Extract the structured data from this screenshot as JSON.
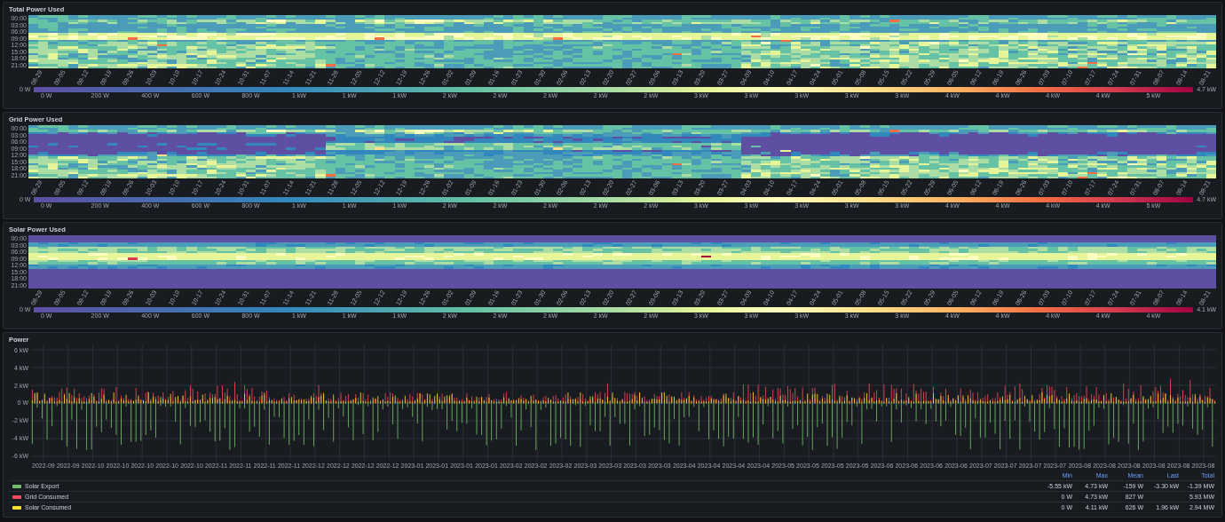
{
  "heatmaps": [
    {
      "title": "Total Power Used",
      "kind": "total",
      "y_labels": [
        "00:00",
        "03:00",
        "06:00",
        "09:00",
        "12:00",
        "15:00",
        "18:00",
        "21:00"
      ],
      "x_labels": [
        "08-29",
        "09-05",
        "09-12",
        "09-19",
        "09-26",
        "10-03",
        "10-10",
        "10-17",
        "10-24",
        "10-31",
        "11-07",
        "11-14",
        "11-21",
        "11-28",
        "12-05",
        "12-12",
        "12-19",
        "12-26",
        "01-02",
        "01-09",
        "01-16",
        "01-23",
        "01-30",
        "02-06",
        "02-13",
        "02-20",
        "02-27",
        "03-06",
        "03-13",
        "03-20",
        "03-27",
        "04-03",
        "04-10",
        "04-17",
        "04-24",
        "05-01",
        "05-08",
        "05-15",
        "05-22",
        "05-29",
        "06-05",
        "06-12",
        "06-19",
        "06-26",
        "07-03",
        "07-10",
        "07-17",
        "07-24",
        "07-31",
        "08-07",
        "08-14",
        "08-21"
      ],
      "scale": {
        "min_label": "0 W",
        "max_label": "4.7 kW",
        "ticks": [
          "0 W",
          "200 W",
          "400 W",
          "600 W",
          "800 W",
          "1 kW",
          "1 kW",
          "1 kW",
          "2 kW",
          "2 kW",
          "2 kW",
          "2 kW",
          "2 kW",
          "3 kW",
          "3 kW",
          "3 kW",
          "3 kW",
          "3 kW",
          "4 kW",
          "4 kW",
          "4 kW",
          "4 kW",
          "5 kW"
        ]
      }
    },
    {
      "title": "Grid Power Used",
      "kind": "grid",
      "y_labels": [
        "00:00",
        "03:00",
        "06:00",
        "09:00",
        "12:00",
        "15:00",
        "18:00",
        "21:00"
      ],
      "x_labels": [
        "08-29",
        "09-05",
        "09-12",
        "09-19",
        "09-26",
        "10-03",
        "10-10",
        "10-17",
        "10-24",
        "10-31",
        "11-07",
        "11-14",
        "11-21",
        "11-28",
        "12-05",
        "12-12",
        "12-19",
        "12-26",
        "01-02",
        "01-09",
        "01-16",
        "01-23",
        "01-30",
        "02-06",
        "02-13",
        "02-20",
        "02-27",
        "03-06",
        "03-13",
        "03-20",
        "03-27",
        "04-03",
        "04-10",
        "04-17",
        "04-24",
        "05-01",
        "05-08",
        "05-15",
        "05-22",
        "05-29",
        "06-05",
        "06-12",
        "06-19",
        "06-26",
        "07-03",
        "07-10",
        "07-17",
        "07-24",
        "07-31",
        "08-07",
        "08-14",
        "08-21"
      ],
      "scale": {
        "min_label": "0 W",
        "max_label": "4.7 kW",
        "ticks": [
          "0 W",
          "200 W",
          "400 W",
          "600 W",
          "800 W",
          "1 kW",
          "1 kW",
          "1 kW",
          "2 kW",
          "2 kW",
          "2 kW",
          "2 kW",
          "2 kW",
          "3 kW",
          "3 kW",
          "3 kW",
          "3 kW",
          "3 kW",
          "4 kW",
          "4 kW",
          "4 kW",
          "4 kW",
          "5 kW"
        ]
      }
    },
    {
      "title": "Solar Power Used",
      "kind": "solar",
      "y_labels": [
        "00:00",
        "03:00",
        "06:00",
        "09:00",
        "12:00",
        "15:00",
        "18:00",
        "21:00"
      ],
      "x_labels": [
        "08-29",
        "09-05",
        "09-12",
        "09-19",
        "09-26",
        "10-03",
        "10-10",
        "10-17",
        "10-24",
        "10-31",
        "11-07",
        "11-14",
        "11-21",
        "11-28",
        "12-05",
        "12-12",
        "12-19",
        "12-26",
        "01-02",
        "01-09",
        "01-16",
        "01-23",
        "01-30",
        "02-06",
        "02-13",
        "02-20",
        "02-27",
        "03-06",
        "03-13",
        "03-20",
        "03-27",
        "04-03",
        "04-10",
        "04-17",
        "04-24",
        "05-01",
        "05-08",
        "05-15",
        "05-22",
        "05-29",
        "06-05",
        "06-12",
        "06-19",
        "06-26",
        "07-03",
        "07-10",
        "07-17",
        "07-24",
        "07-31",
        "08-07",
        "08-14",
        "08-21"
      ],
      "scale": {
        "min_label": "0 W",
        "max_label": "4.1 kW",
        "ticks": [
          "0 W",
          "200 W",
          "400 W",
          "600 W",
          "800 W",
          "1 kW",
          "1 kW",
          "1 kW",
          "2 kW",
          "2 kW",
          "2 kW",
          "2 kW",
          "2 kW",
          "3 kW",
          "3 kW",
          "3 kW",
          "3 kW",
          "3 kW",
          "4 kW",
          "4 kW",
          "4 kW",
          "4 kW",
          "4 kW"
        ]
      }
    }
  ],
  "power": {
    "title": "Power",
    "y_ticks": [
      "6 kW",
      "4 kW",
      "2 kW",
      "0 W",
      "-2 kW",
      "-4 kW",
      "-6 kW"
    ],
    "x_labels": [
      "2022-09",
      "2022-09",
      "2022-10",
      "2022-10",
      "2022-10",
      "2022-10",
      "2022-10",
      "2022-11",
      "2022-11",
      "2022-11",
      "2022-11",
      "2022-12",
      "2022-12",
      "2022-12",
      "2022-12",
      "2023-01",
      "2023-01",
      "2023-01",
      "2023-01",
      "2023-02",
      "2023-02",
      "2023-02",
      "2023-03",
      "2023-03",
      "2023-03",
      "2023-03",
      "2023-04",
      "2023-04",
      "2023-04",
      "2023-04",
      "2023-05",
      "2023-05",
      "2023-05",
      "2023-05",
      "2023-06",
      "2023-06",
      "2023-06",
      "2023-06",
      "2023-07",
      "2023-07",
      "2023-07",
      "2023-07",
      "2023-08",
      "2023-08",
      "2023-08",
      "2023-08",
      "2023-08",
      "2023-08"
    ],
    "legend": {
      "columns": [
        "Min",
        "Max",
        "Mean",
        "Last",
        "Total"
      ],
      "series": [
        {
          "name": "Solar Export",
          "kind": "export",
          "color": "#73bf69",
          "stats": {
            "min": "-5.55 kW",
            "max": "4.73 kW",
            "mean": "-159 W",
            "last": "-3.30 kW",
            "total": "-1.39 MW"
          }
        },
        {
          "name": "Grid Consumed",
          "kind": "grid",
          "color": "#f2495c",
          "stats": {
            "min": "0 W",
            "max": "4.73 kW",
            "mean": "827 W",
            "total": "5.93 MW"
          }
        },
        {
          "name": "Solar Consumed",
          "kind": "solar",
          "color": "#fade2a",
          "stats": {
            "min": "0 W",
            "max": "4.11 kW",
            "mean": "626 W",
            "last": "1.96 kW",
            "total": "2.94 MW"
          }
        }
      ]
    }
  }
}
